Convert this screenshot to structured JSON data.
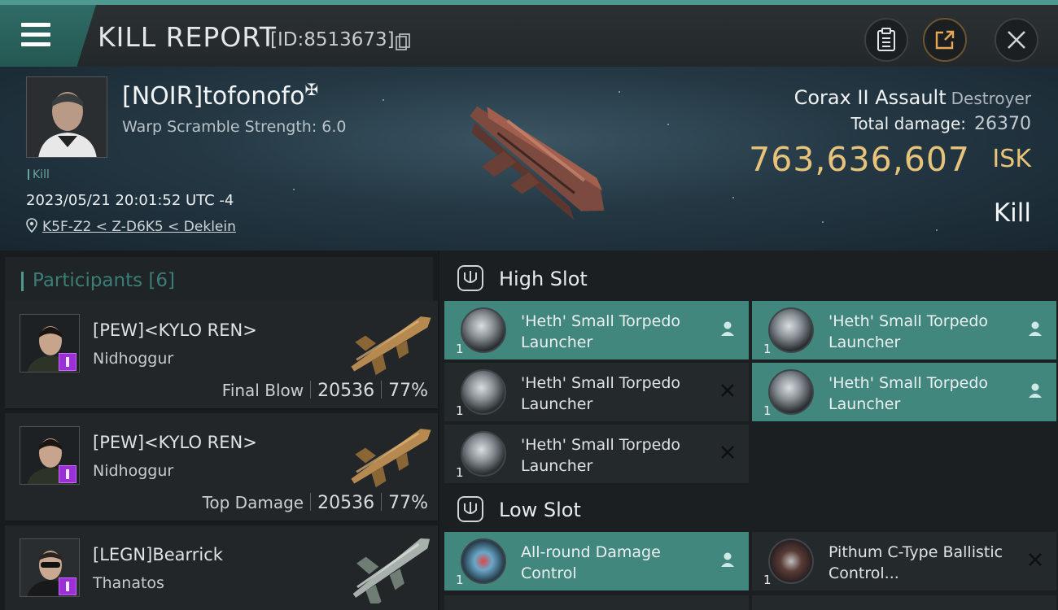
{
  "header": {
    "title": "KILL REPORT",
    "id_text": "[ID:8513673]"
  },
  "victim": {
    "name": "[NOIR]tofonofo",
    "corp_mark": "✠",
    "warp_scramble": "Warp Scramble Strength: 6.0",
    "tag": "Kill",
    "datetime": "2023/05/21 20:01:52 UTC -4",
    "location": "K5F-Z2 < Z-D6K5 < Deklein"
  },
  "ship": {
    "name": "Corax II Assault",
    "class": "Destroyer",
    "total_damage_label": "Total damage:",
    "total_damage_value": "26370",
    "isk_value": "763,636,607",
    "isk_label": "ISK",
    "result": "Kill"
  },
  "participants": {
    "label": "Participants",
    "count": "[6]",
    "items": [
      {
        "name": "[PEW]<KYLO REN>",
        "ship": "Nidhoggur",
        "role": "Final Blow",
        "damage": "20536",
        "percent": "77%"
      },
      {
        "name": "[PEW]<KYLO REN>",
        "ship": "Nidhoggur",
        "role": "Top Damage",
        "damage": "20536",
        "percent": "77%"
      },
      {
        "name": "[LEGN]Bearrick",
        "ship": "Thanatos",
        "role": "",
        "damage": "",
        "percent": ""
      }
    ]
  },
  "fitting": {
    "high_slot": {
      "label": "High Slot",
      "modules": [
        {
          "name": "'Heth' Small Torpedo Launcher",
          "qty": "1",
          "state": "fitted"
        },
        {
          "name": "'Heth' Small Torpedo Launcher",
          "qty": "1",
          "state": "fitted"
        },
        {
          "name": "'Heth' Small Torpedo Launcher",
          "qty": "1",
          "state": "destroyed"
        },
        {
          "name": "'Heth' Small Torpedo Launcher",
          "qty": "1",
          "state": "fitted"
        },
        {
          "name": "'Heth' Small Torpedo Launcher",
          "qty": "1",
          "state": "destroyed"
        }
      ]
    },
    "low_slot": {
      "label": "Low Slot",
      "modules": [
        {
          "name": "All-round Damage Control",
          "qty": "1",
          "state": "fitted"
        },
        {
          "name": "Pithum C-Type Ballistic Control...",
          "qty": "1",
          "state": "destroyed"
        }
      ]
    }
  },
  "colors": {
    "accent": "#4f9a90",
    "isk": "#e8c37a",
    "fitted_module_bg": "#42877e",
    "pilot_badge": "#9b30d6"
  },
  "icons": {
    "menu": "hamburger-menu-icon",
    "copy": "copy-icon",
    "clipboard": "clipboard-icon",
    "share": "share-icon",
    "close": "close-icon",
    "location": "location-pin-icon",
    "slot": "slot-icon",
    "pilot": "pilot-icon",
    "destroyed": "x-icon"
  }
}
